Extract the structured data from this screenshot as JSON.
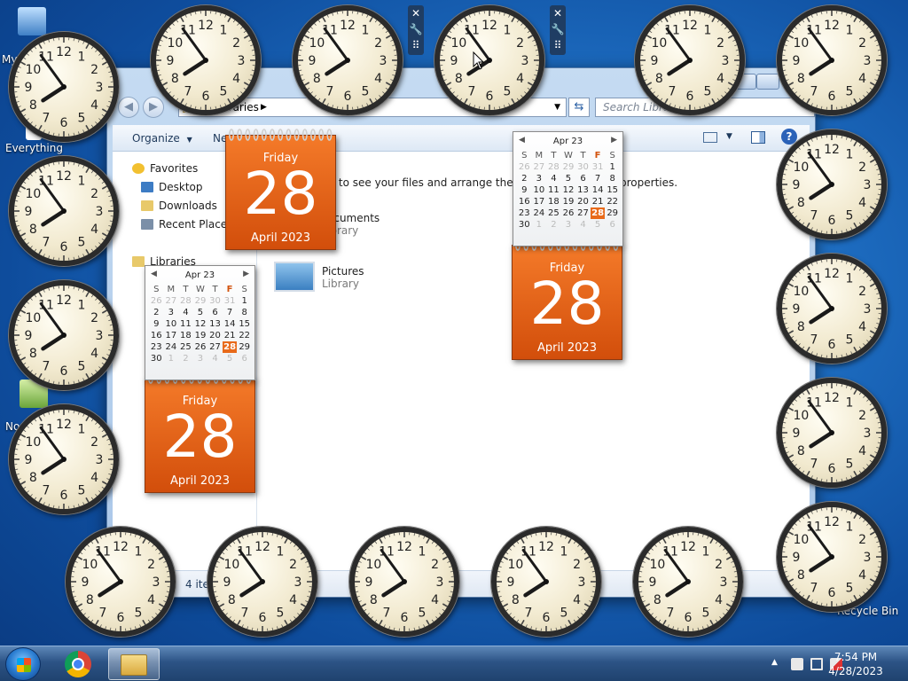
{
  "desktop": {
    "icons": [
      {
        "label": "My"
      },
      {
        "label": "Everything"
      },
      {
        "label": "No"
      }
    ],
    "recycle_bin_label": "Recycle Bin"
  },
  "explorer": {
    "address_path": "Libraries",
    "search_placeholder": "Search Libra",
    "toolbar": {
      "organize_label": "Organize",
      "new_label": "Ne"
    },
    "nav_pane": {
      "favorites_label": "Favorites",
      "favorites": [
        "Desktop",
        "Downloads",
        "Recent Places"
      ],
      "libraries_label": "Libraries"
    },
    "main": {
      "intro_text": "y to see your files and arrange them by",
      "intro_tail": "properties.",
      "items": [
        {
          "name": "ocuments",
          "sub": "ibrary"
        },
        {
          "name": "Pictures",
          "sub": "Library"
        }
      ]
    },
    "status_text": "4 item"
  },
  "gadgets": {
    "date_card": {
      "day": "Friday",
      "number": "28",
      "month": "April 2023"
    },
    "month_card": {
      "header": "Apr 23",
      "weekdays": [
        "S",
        "M",
        "T",
        "W",
        "T",
        "F",
        "S"
      ],
      "weeks": [
        [
          "26",
          "27",
          "28",
          "29",
          "30",
          "31",
          "1"
        ],
        [
          "2",
          "3",
          "4",
          "5",
          "6",
          "7",
          "8"
        ],
        [
          "9",
          "10",
          "11",
          "12",
          "13",
          "14",
          "15"
        ],
        [
          "16",
          "17",
          "18",
          "19",
          "20",
          "21",
          "22"
        ],
        [
          "23",
          "24",
          "25",
          "26",
          "27",
          "28",
          "29"
        ],
        [
          "30",
          "1",
          "2",
          "3",
          "4",
          "5",
          "6"
        ]
      ]
    },
    "clock_numerals": [
      "12",
      "1",
      "2",
      "3",
      "4",
      "5",
      "6",
      "7",
      "8",
      "9",
      "10",
      "11"
    ],
    "clock_time": {
      "hour": 7,
      "minute": 54
    },
    "sidebar_controls": {
      "close": "✕",
      "options": "🔧",
      "drag": "⠿"
    }
  },
  "taskbar": {
    "time": "7:54 PM",
    "date": "4/28/2023",
    "tray_icons": [
      "show-hidden-icons-icon",
      "action-center-icon",
      "network-icon",
      "volume-muted-icon"
    ]
  },
  "colors": {
    "desktop_blue": "#1d6cc0",
    "date_card_orange": "#e2621a",
    "today_highlight": "#e86a1a",
    "taskbar": "#2c5385"
  }
}
